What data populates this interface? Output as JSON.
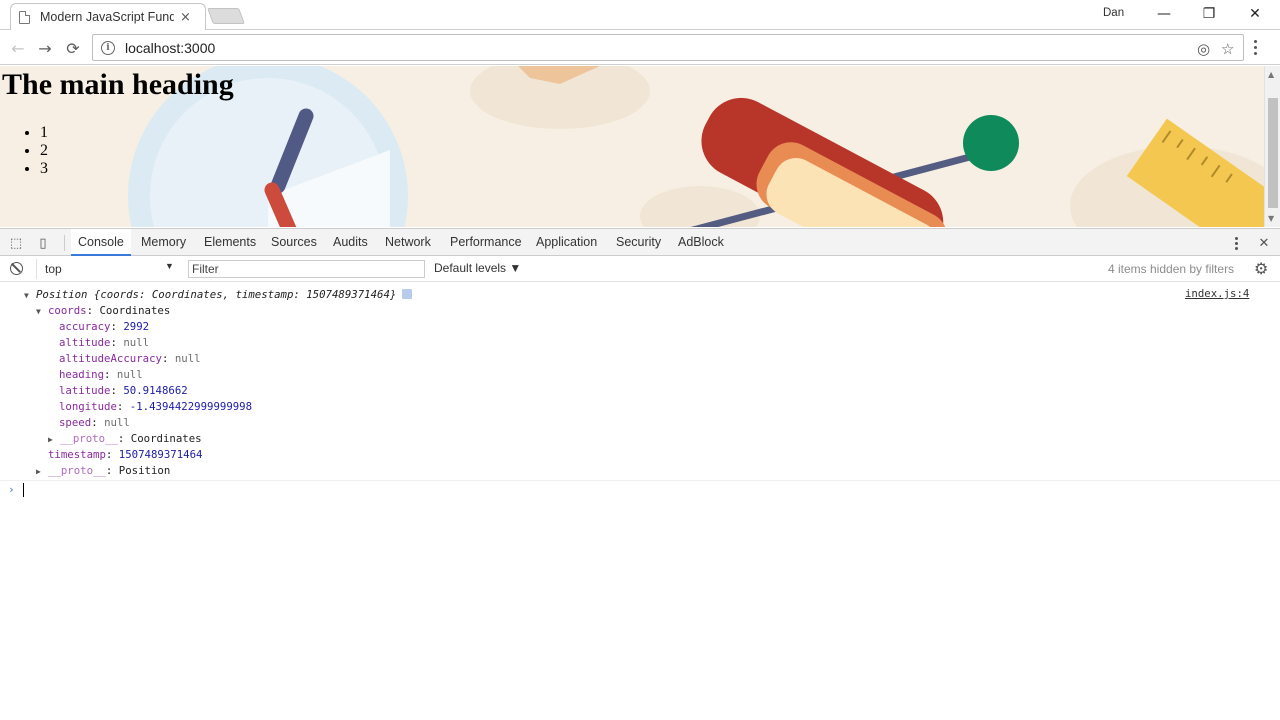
{
  "browser": {
    "tab_title": "Modern JavaScript Funda",
    "tab_close": "×",
    "user": "Dan",
    "url": "localhost:3000",
    "window_controls": {
      "minimize": "—",
      "restore": "❐",
      "close": "✕"
    },
    "nav": {
      "back": "←",
      "forward": "→",
      "reload": "⟳",
      "target": "◎",
      "star": "☆"
    }
  },
  "page": {
    "heading": "The main heading",
    "list": [
      "1",
      "2",
      "3"
    ]
  },
  "devtools": {
    "tabs": [
      "Console",
      "Memory",
      "Elements",
      "Sources",
      "Audits",
      "Network",
      "Performance",
      "Application",
      "Security",
      "AdBlock"
    ],
    "active_tab": "Console",
    "context": "top",
    "filter_placeholder": "Filter",
    "levels": "Default levels ▼",
    "hidden": "4 items hidden by filters",
    "close": "✕"
  },
  "console": {
    "source": "index.js:4",
    "header": "Position {coords: Coordinates, timestamp: 1507489371464}",
    "coords_key": "coords",
    "coords_type": "Coordinates",
    "props": [
      {
        "key": "accuracy",
        "value": "2992",
        "kind": "num"
      },
      {
        "key": "altitude",
        "value": "null",
        "kind": "nul"
      },
      {
        "key": "altitudeAccuracy",
        "value": "null",
        "kind": "nul"
      },
      {
        "key": "heading",
        "value": "null",
        "kind": "nul"
      },
      {
        "key": "latitude",
        "value": "50.9148662",
        "kind": "num"
      },
      {
        "key": "longitude",
        "value": "-1.4394422999999998",
        "kind": "num"
      },
      {
        "key": "speed",
        "value": "null",
        "kind": "nul"
      }
    ],
    "coords_proto_key": "__proto__",
    "coords_proto_value": "Coordinates",
    "timestamp_key": "timestamp",
    "timestamp_value": "1507489371464",
    "proto_key": "__proto__",
    "proto_value": "Position",
    "prompt": "›"
  }
}
